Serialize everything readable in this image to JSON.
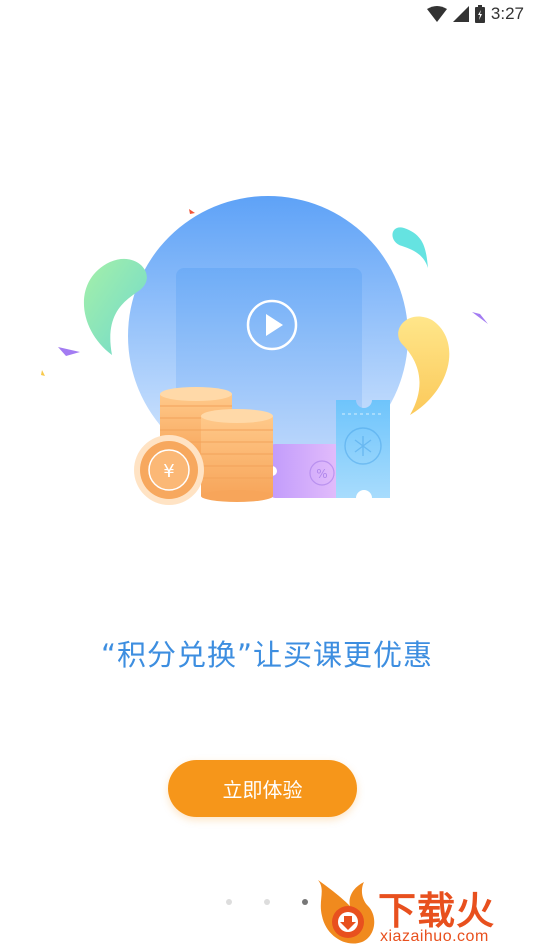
{
  "status_bar": {
    "time": "3:27",
    "icons": [
      "wifi-icon",
      "cell-signal-icon",
      "battery-icon"
    ]
  },
  "illustration": {
    "icons": [
      "play-icon",
      "coin-stack-icon",
      "yuan-coin-icon",
      "discount-coupon-icon",
      "ticket-icon"
    ],
    "coin_symbol": "¥",
    "coupon_symbol": "%"
  },
  "slogan": "“积分兑换”让买课更优惠",
  "cta_label": "立即体验",
  "pagination": {
    "total": 3,
    "active_index": 2
  },
  "watermark": {
    "title": "下载火",
    "domain": "xiazaihuo.com"
  },
  "colors": {
    "accent_blue": "#3d8ee0",
    "button_orange": "#f6961a",
    "watermark_red": "#e8501e"
  }
}
